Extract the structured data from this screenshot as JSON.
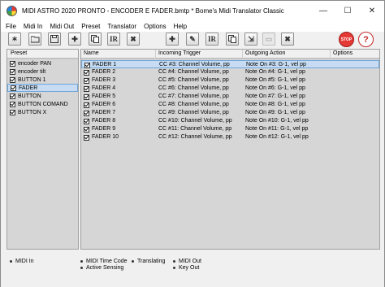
{
  "window": {
    "title": "MIDI ASTRO 2020 PRONTO - ENCODER E FADER.bmtp * Bome's Midi Translator Classic",
    "minimize": "—",
    "maximize": "☐",
    "close": "✕"
  },
  "menu": [
    "File",
    "Midi In",
    "Midi Out",
    "Preset",
    "Translator",
    "Options",
    "Help"
  ],
  "toolbar": {
    "stop_label": "STOP",
    "help_label": "?"
  },
  "preset_panel": {
    "header": "Preset",
    "items": [
      {
        "label": "encoder PAN",
        "checked": true
      },
      {
        "label": "encoder tilt",
        "checked": true
      },
      {
        "label": "BUTTON 1",
        "checked": true
      },
      {
        "label": "FADER",
        "checked": true
      },
      {
        "label": "BUTTON",
        "checked": true
      },
      {
        "label": "BUTTON COMAND",
        "checked": true
      },
      {
        "label": "BUTTON X",
        "checked": true
      }
    ]
  },
  "translator_panel": {
    "columns": [
      "Name",
      "Incoming Trigger",
      "Outgoing Action",
      "Options"
    ],
    "rows": [
      {
        "name": "FADER 1",
        "trigger": "CC #3: Channel Volume, pp",
        "action": "Note On #3: G-1, vel pp"
      },
      {
        "name": "FADER 2",
        "trigger": "CC #4: Channel Volume, pp",
        "action": "Note On #4: G-1, vel pp"
      },
      {
        "name": "FADER 3",
        "trigger": "CC #5: Channel Volume, pp",
        "action": "Note On #5: G-1, vel pp"
      },
      {
        "name": "FADER 4",
        "trigger": "CC #6: Channel Volume, pp",
        "action": "Note On #6: G-1, vel pp"
      },
      {
        "name": "FADER 5",
        "trigger": "CC #7: Channel Volume, pp",
        "action": "Note On #7: G-1, vel pp"
      },
      {
        "name": "FADER 6",
        "trigger": "CC #8: Channel Volume, pp",
        "action": "Note On #8: G-1, vel pp"
      },
      {
        "name": "FADER 7",
        "trigger": "CC #9: Channel Volume, pp",
        "action": "Note On #9: G-1, vel pp"
      },
      {
        "name": "FADER 8",
        "trigger": "CC #10: Channel Volume, pp",
        "action": "Note On #10: G-1, vel pp"
      },
      {
        "name": "FADER 9",
        "trigger": "CC #11: Channel Volume, pp",
        "action": "Note On #11: G-1, vel pp"
      },
      {
        "name": "FADER 10",
        "trigger": "CC #12: Channel Volume, pp",
        "action": "Note On #12: G-1, vel pp"
      }
    ]
  },
  "status": {
    "midi_in": "MIDI In",
    "midi_time_code": "MIDI Time Code",
    "active_sensing": "Active Sensing",
    "translating": "Translating",
    "midi_out": "MIDI Out",
    "key_out": "Key Out"
  }
}
